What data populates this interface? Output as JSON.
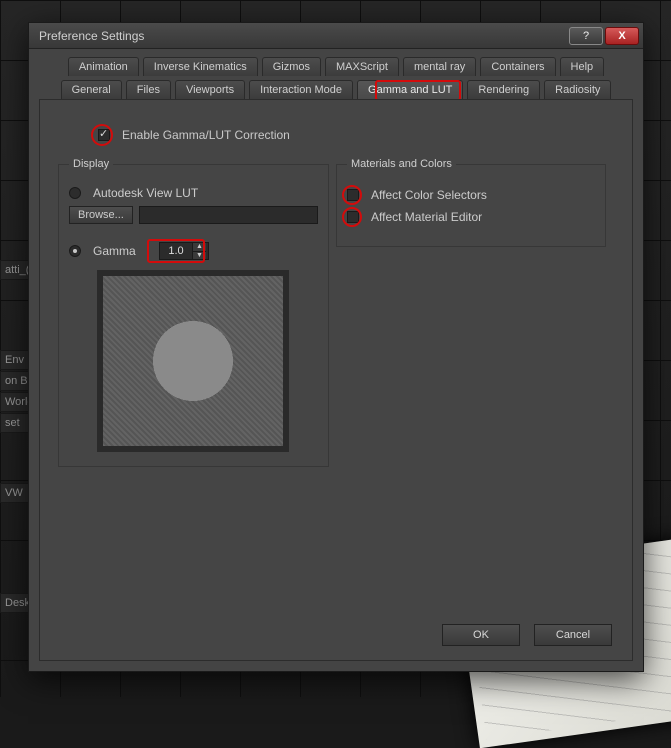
{
  "window": {
    "title": "Preference Settings",
    "help_label": "?",
    "close_label": "X"
  },
  "tabs": {
    "row1": [
      "Animation",
      "Inverse Kinematics",
      "Gizmos",
      "MAXScript",
      "mental ray",
      "Containers",
      "Help"
    ],
    "row2": [
      "General",
      "Files",
      "Viewports",
      "Interaction Mode",
      "Gamma and LUT",
      "Rendering",
      "Radiosity"
    ],
    "active": "Gamma and LUT"
  },
  "enable": {
    "label": "Enable Gamma/LUT Correction",
    "checked": true
  },
  "display": {
    "legend": "Display",
    "autodesk_label": "Autodesk View LUT",
    "autodesk_selected": false,
    "browse_label": "Browse...",
    "path_value": "",
    "gamma_label": "Gamma",
    "gamma_selected": true,
    "gamma_value": "1.0"
  },
  "materials": {
    "legend": "Materials and Colors",
    "affect_color_label": "Affect Color Selectors",
    "affect_color_checked": false,
    "affect_mat_label": "Affect Material Editor",
    "affect_mat_checked": false
  },
  "footer": {
    "ok": "OK",
    "cancel": "Cancel"
  },
  "background": {
    "frag1": "atti_(",
    "frag2": " Env",
    "frag3": "on Ba",
    "frag4": "World",
    "frag5": "set ",
    "frag6": "VW",
    "frag7": "Desk"
  },
  "highlights": {
    "color": "#d30b0b"
  }
}
